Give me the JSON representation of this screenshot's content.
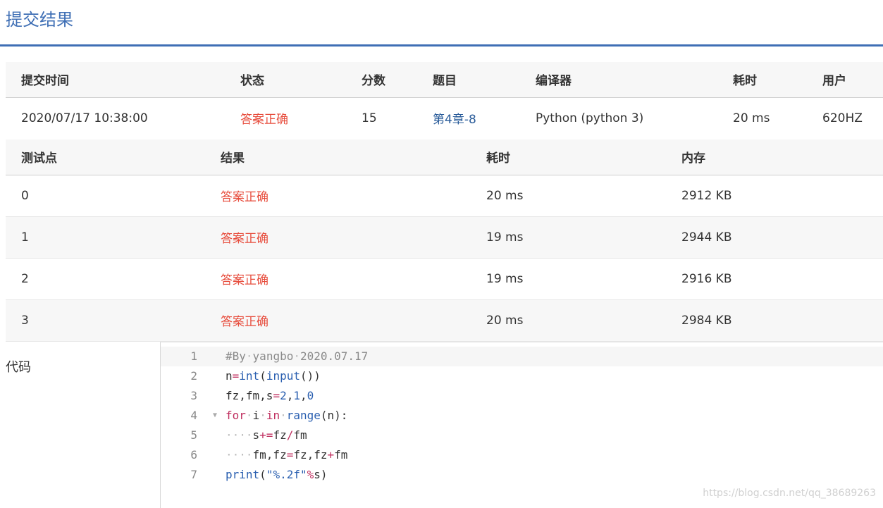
{
  "page": {
    "title": "提交结果"
  },
  "summary": {
    "headers": [
      "提交时间",
      "状态",
      "分数",
      "题目",
      "编译器",
      "耗时",
      "用户"
    ],
    "row": {
      "time": "2020/07/17 10:38:00",
      "status": "答案正确",
      "score": "15",
      "problem": "第4章-8",
      "compiler": "Python (python 3)",
      "elapsed": "20 ms",
      "user": "620HZ"
    }
  },
  "cases": {
    "headers": [
      "测试点",
      "结果",
      "耗时",
      "内存"
    ],
    "rows": [
      {
        "id": "0",
        "result": "答案正确",
        "time": "20 ms",
        "memory": "2912 KB"
      },
      {
        "id": "1",
        "result": "答案正确",
        "time": "19 ms",
        "memory": "2944 KB"
      },
      {
        "id": "2",
        "result": "答案正确",
        "time": "19 ms",
        "memory": "2916 KB"
      },
      {
        "id": "3",
        "result": "答案正确",
        "time": "20 ms",
        "memory": "2984 KB"
      }
    ]
  },
  "code": {
    "label": "代码",
    "lines": [
      {
        "n": "1",
        "text": "#By yangbo 2020.07.17"
      },
      {
        "n": "2",
        "text": "n=int(input())"
      },
      {
        "n": "3",
        "text": "fz,fm,s=2,1,0"
      },
      {
        "n": "4",
        "text": "for i in range(n):"
      },
      {
        "n": "5",
        "text": "    s+=fz/fm"
      },
      {
        "n": "6",
        "text": "    fm,fz=fz,fz+fm"
      },
      {
        "n": "7",
        "text": "print(\"%.2f\"%s)"
      }
    ]
  },
  "watermark": "https://blog.csdn.net/qq_38689263",
  "colors": {
    "accent": "#3f6fb5",
    "success": "#e74c3c",
    "link": "#2a5c9a"
  },
  "icons": {
    "fold": "fold-arrow-icon"
  }
}
